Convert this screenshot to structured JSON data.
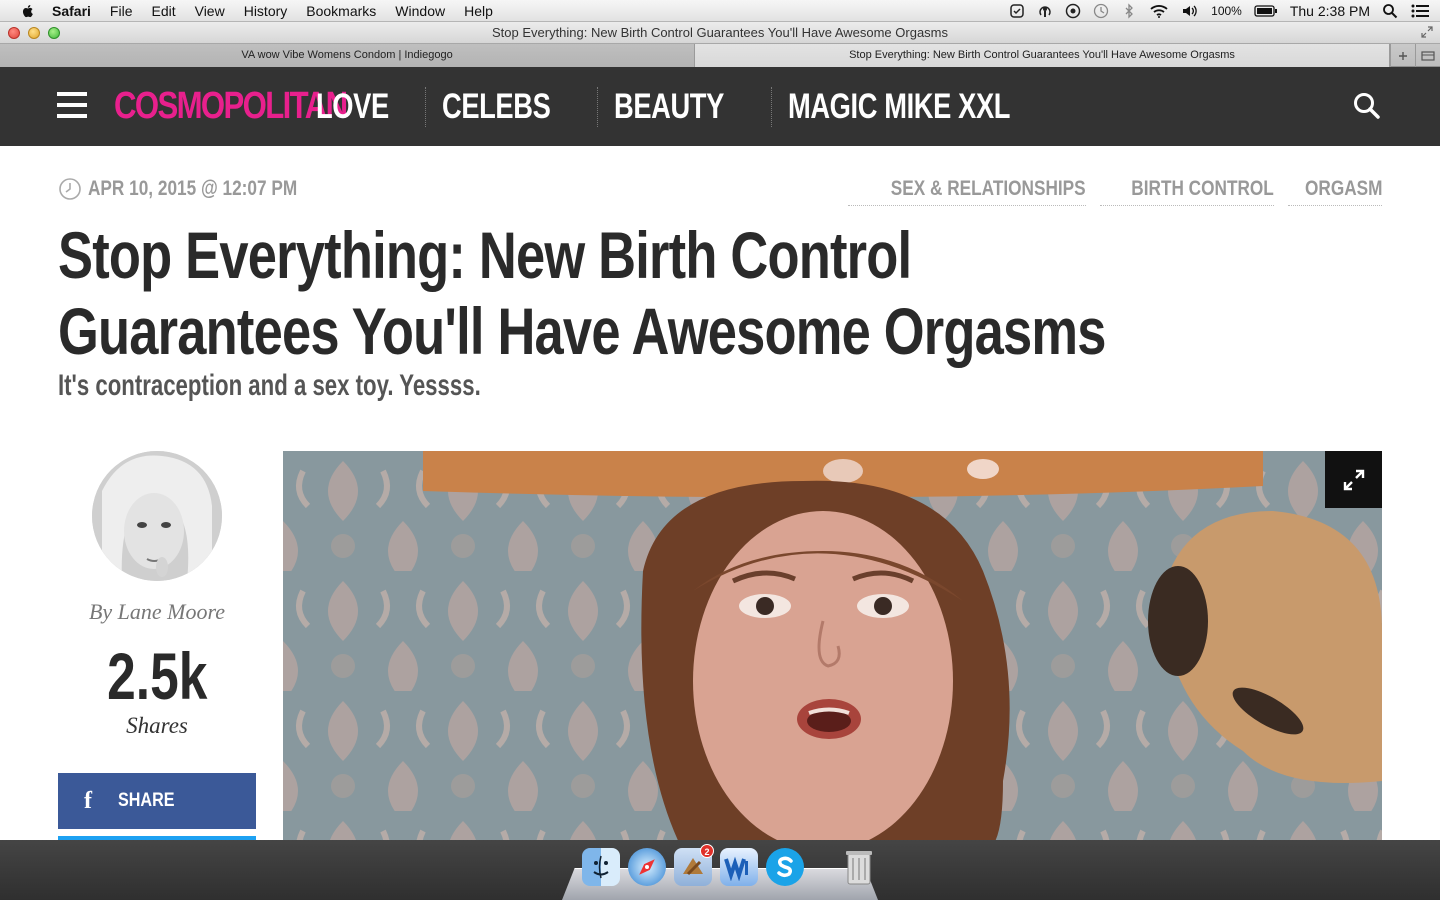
{
  "menubar": {
    "app": "Safari",
    "items": [
      "File",
      "Edit",
      "View",
      "History",
      "Bookmarks",
      "Window",
      "Help"
    ],
    "battery": "100%",
    "clock": "Thu 2:38 PM"
  },
  "window": {
    "title": "Stop Everything: New Birth Control Guarantees You'll Have Awesome Orgasms"
  },
  "tabs": [
    {
      "label": "VA wow Vibe Womens Condom | Indiegogo",
      "active": false
    },
    {
      "label": "Stop Everything: New Birth Control Guarantees You'll Have Awesome Orgasms",
      "active": true
    }
  ],
  "site": {
    "logo": "COSMOPOLITAN",
    "brand_color": "#e8208d",
    "nav": [
      "LOVE",
      "CELEBS",
      "BEAUTY",
      "MAGIC MIKE XXL"
    ]
  },
  "article": {
    "date": "APR 10, 2015 @ 12:07 PM",
    "tags": [
      "SEX & RELATIONSHIPS",
      "BIRTH CONTROL",
      "ORGASM"
    ],
    "headline": "Stop Everything: New Birth Control Guarantees You'll Have Awesome Orgasms",
    "dek": "It's contraception and a sex toy. Yessss.",
    "byline": "By Lane Moore",
    "share_count": "2.5k",
    "share_label": "Shares",
    "facebook_share": "SHARE"
  },
  "dock": {
    "mail_badge": "2"
  }
}
